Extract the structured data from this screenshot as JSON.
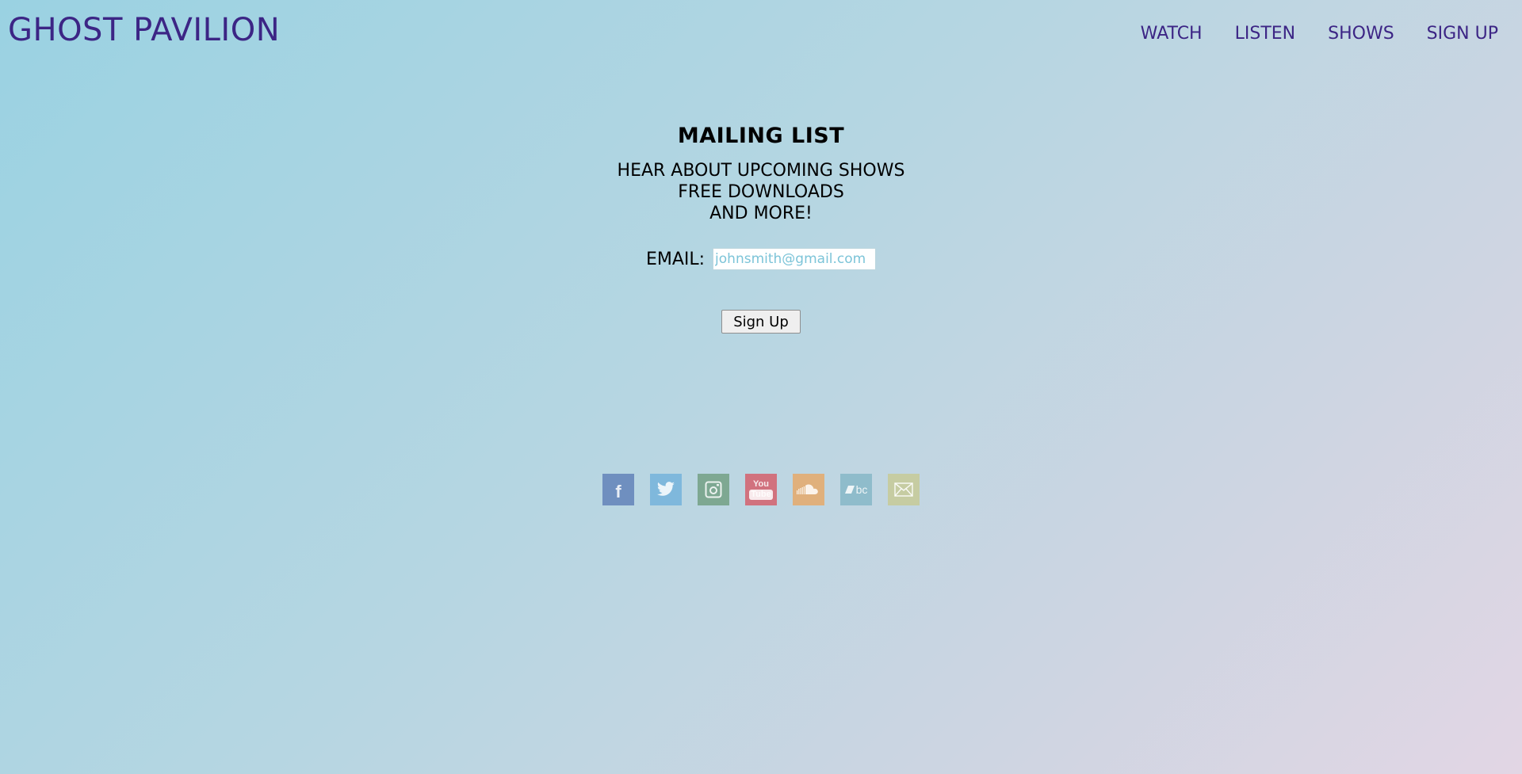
{
  "header": {
    "site_title": "GHOST PAVILION",
    "nav": [
      {
        "label": "WATCH"
      },
      {
        "label": "LISTEN"
      },
      {
        "label": "SHOWS"
      },
      {
        "label": "SIGN UP"
      }
    ]
  },
  "mailing": {
    "heading": "MAILING LIST",
    "lines": [
      "HEAR ABOUT UPCOMING SHOWS",
      "FREE DOWNLOADS",
      "AND MORE!"
    ],
    "email_label": "EMAIL:",
    "email_placeholder": "johnsmith@gmail.com",
    "email_value": "",
    "submit_label": "Sign Up"
  },
  "social": [
    {
      "name": "facebook-icon",
      "glyph": "f",
      "color": "#6f8fbf"
    },
    {
      "name": "twitter-icon",
      "color": "#7fb8dc"
    },
    {
      "name": "instagram-icon",
      "color": "#7ea892"
    },
    {
      "name": "youtube-icon",
      "glyph_top": "You",
      "glyph_bottom": "Tube",
      "color": "#d1727e"
    },
    {
      "name": "soundcloud-icon",
      "color": "#e0b07c"
    },
    {
      "name": "bandcamp-icon",
      "glyph": "bc",
      "color": "#8fbccb"
    },
    {
      "name": "email-icon",
      "color": "#c6cca2"
    }
  ],
  "colors": {
    "accent": "#3c2585",
    "background_start": "#9ad2e2",
    "background_end": "#e2d6e4"
  }
}
